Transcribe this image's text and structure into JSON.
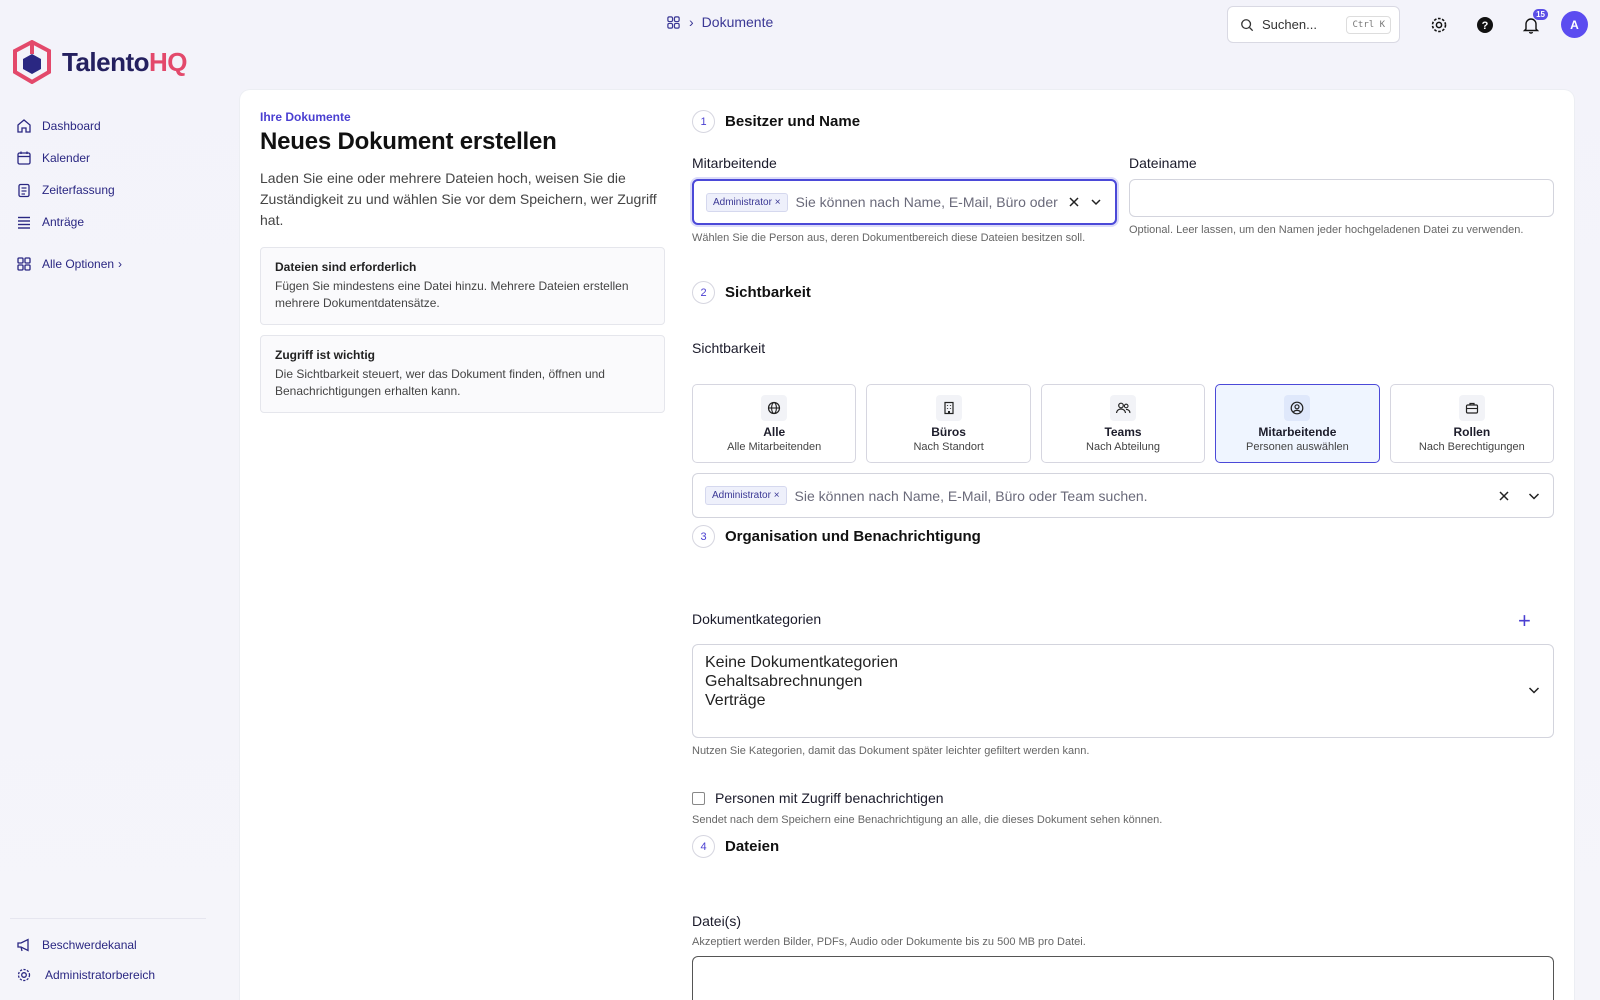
{
  "app": {
    "brand_main": "Talento",
    "brand_accent": "HQ",
    "brand_color": "#24205f",
    "accent_color": "#e3496b"
  },
  "sidebar": {
    "items": [
      {
        "label": "Dashboard",
        "icon": "home-icon"
      },
      {
        "label": "Kalender",
        "icon": "calendar-icon"
      },
      {
        "label": "Zeiterfassung",
        "icon": "clipboard-icon"
      },
      {
        "label": "Anträge",
        "icon": "list-icon"
      }
    ],
    "all_options": "Alle Optionen",
    "bottom": [
      {
        "label": "Beschwerdekanal",
        "icon": "megaphone-icon"
      },
      {
        "label": "Administratorbereich",
        "icon": "gear-icon"
      }
    ]
  },
  "header": {
    "breadcrumb": "Dokumente",
    "search_placeholder": "Suchen...",
    "search_shortcut": "Ctrl K",
    "notification_count": "15",
    "avatar_initial": "A"
  },
  "intro": {
    "eyebrow": "Ihre Dokumente",
    "title": "Neues Dokument erstellen",
    "description": "Laden Sie eine oder mehrere Dateien hoch, weisen Sie die Zuständigkeit zu und wählen Sie vor dem Speichern, wer Zugriff hat.",
    "boxes": [
      {
        "title": "Dateien sind erforderlich",
        "text": "Fügen Sie mindestens eine Datei hinzu. Mehrere Dateien erstellen mehrere Dokumentdatensätze."
      },
      {
        "title": "Zugriff ist wichtig",
        "text": "Die Sichtbarkeit steuert, wer das Dokument finden, öffnen und Benachrichtigungen erhalten kann."
      }
    ]
  },
  "form": {
    "step1": {
      "num": "1",
      "title": "Besitzer und Name"
    },
    "employees_label": "Mitarbeitende",
    "employees_chip": "Administrator",
    "employees_placeholder": "Sie können nach Name, E-Mail, Büro oder Team s",
    "employees_help": "Wählen Sie die Person aus, deren Dokumentbereich diese Dateien besitzen soll.",
    "filename_label": "Dateiname",
    "filename_value": "",
    "filename_help": "Optional. Leer lassen, um den Namen jeder hochgeladenen Datei zu verwenden.",
    "step2": {
      "num": "2",
      "title": "Sichtbarkeit"
    },
    "visibility_label": "Sichtbarkeit",
    "visibility_options": [
      {
        "name": "Alle",
        "sub": "Alle Mitarbeitenden",
        "icon": "globe-icon",
        "selected": false
      },
      {
        "name": "Büros",
        "sub": "Nach Standort",
        "icon": "building-icon",
        "selected": false
      },
      {
        "name": "Teams",
        "sub": "Nach Abteilung",
        "icon": "users-icon",
        "selected": false
      },
      {
        "name": "Mitarbeitende",
        "sub": "Personen auswählen",
        "icon": "user-circle-icon",
        "selected": true
      },
      {
        "name": "Rollen",
        "sub": "Nach Berechtigungen",
        "icon": "briefcase-icon",
        "selected": false
      }
    ],
    "visibility_chip": "Administrator",
    "visibility_placeholder": "Sie können nach Name, E-Mail, Büro oder Team suchen.",
    "step3": {
      "num": "3",
      "title": "Organisation und Benachrichtigung"
    },
    "categories_label": "Dokumentkategorien",
    "categories": [
      "Keine Dokumentkategorien",
      "Gehaltsabrechnungen",
      "Verträge"
    ],
    "categories_help": "Nutzen Sie Kategorien, damit das Dokument später leichter gefiltert werden kann.",
    "notify_label": "Personen mit Zugriff benachrichtigen",
    "notify_checked": false,
    "notify_help": "Sendet nach dem Speichern eine Benachrichtigung an alle, die dieses Dokument sehen können.",
    "step4": {
      "num": "4",
      "title": "Dateien"
    },
    "files_label": "Datei(s)",
    "files_help": "Akzeptiert werden Bilder, PDFs, Audio oder Dokumente bis zu 500 MB pro Datei."
  }
}
